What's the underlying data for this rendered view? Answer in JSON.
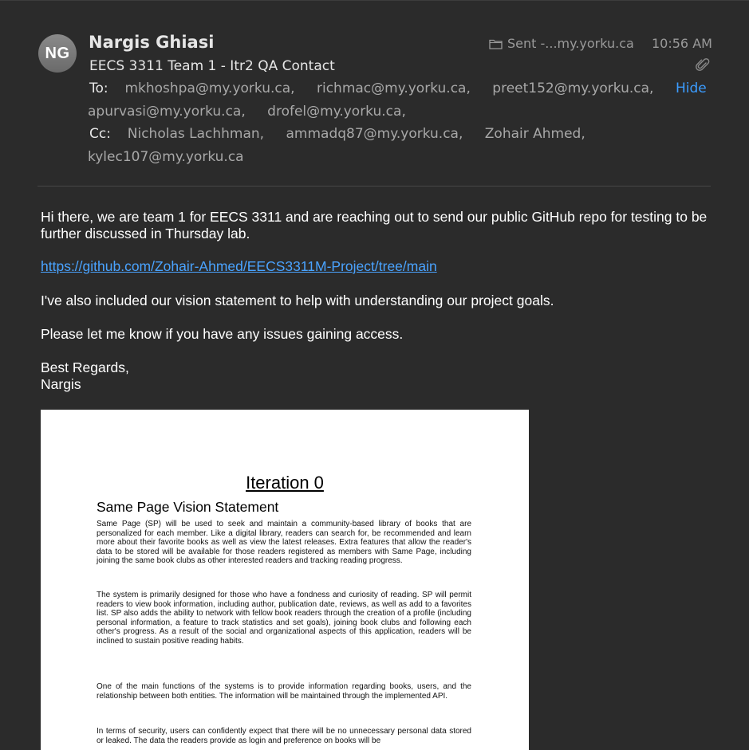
{
  "colors": {
    "background": "#2b2b2b",
    "link": "#4aa3ff",
    "hide_button": "#3b9cff",
    "muted": "#9a9a9a"
  },
  "header": {
    "avatar_initials": "NG",
    "sender_name": "Nargis Ghiasi",
    "subject": "EECS 3311 Team 1 - Itr2 QA Contact",
    "mailbox": "Sent -...my.yorku.ca",
    "time": "10:56 AM",
    "hide_label": "Hide",
    "to_label": "To:",
    "to": [
      "mkhoshpa@my.yorku.ca,",
      "richmac@my.yorku.ca,",
      "preet152@my.yorku.ca,",
      "apurvasi@my.yorku.ca,",
      "drofel@my.yorku.ca,"
    ],
    "cc_label": "Cc:",
    "cc": [
      "Nicholas Lachhman,",
      "ammadq87@my.yorku.ca,",
      "Zohair Ahmed,",
      "kylec107@my.yorku.ca"
    ],
    "icons": {
      "folder": "folder-icon",
      "attachment": "paperclip-icon"
    }
  },
  "message": {
    "paragraph1": "Hi there, we are team 1 for EECS 3311 and are reaching out to send our public GitHub repo for testing to be further discussed in Thursday lab.",
    "link": "https://github.com/Zohair-Ahmed/EECS3311M-Project/tree/main",
    "paragraph2": "I've also included our vision statement to help with understanding our project goals.",
    "paragraph3": "Please let me know if you have any issues gaining access.",
    "signoff": "Best Regards,",
    "signature": "Nargis"
  },
  "attachment": {
    "title": "Iteration 0",
    "heading": "Same Page Vision Statement",
    "paragraphs": [
      "Same Page (SP) will be used to seek and maintain a community-based library of books that are personalized for each member. Like a digital library, readers can search for, be recommended and learn more about their favorite books as well as view the latest releases. Extra features that allow the reader's data to be stored will be available for those readers registered as members with Same Page, including joining the same book clubs as other interested readers and tracking reading progress.",
      "The system is primarily designed for those who have a fondness and curiosity of reading. SP will permit readers to view book information, including author, publication date, reviews, as well as add to a favorites list. SP also adds the ability to network with fellow book readers through the creation of a profile (including personal information, a feature to track statistics and set goals), joining book clubs and following each other's progress. As a result of the social and organizational aspects of this application, readers will be inclined to sustain positive reading habits.",
      "One of the main functions of the systems is to provide information regarding books, users, and the relationship between both entities. The information will be maintained through the implemented API.",
      "In terms of security, users can confidently expect that there will be no unnecessary personal data stored or leaked. The data the readers provide as login and preference on books will be"
    ]
  }
}
